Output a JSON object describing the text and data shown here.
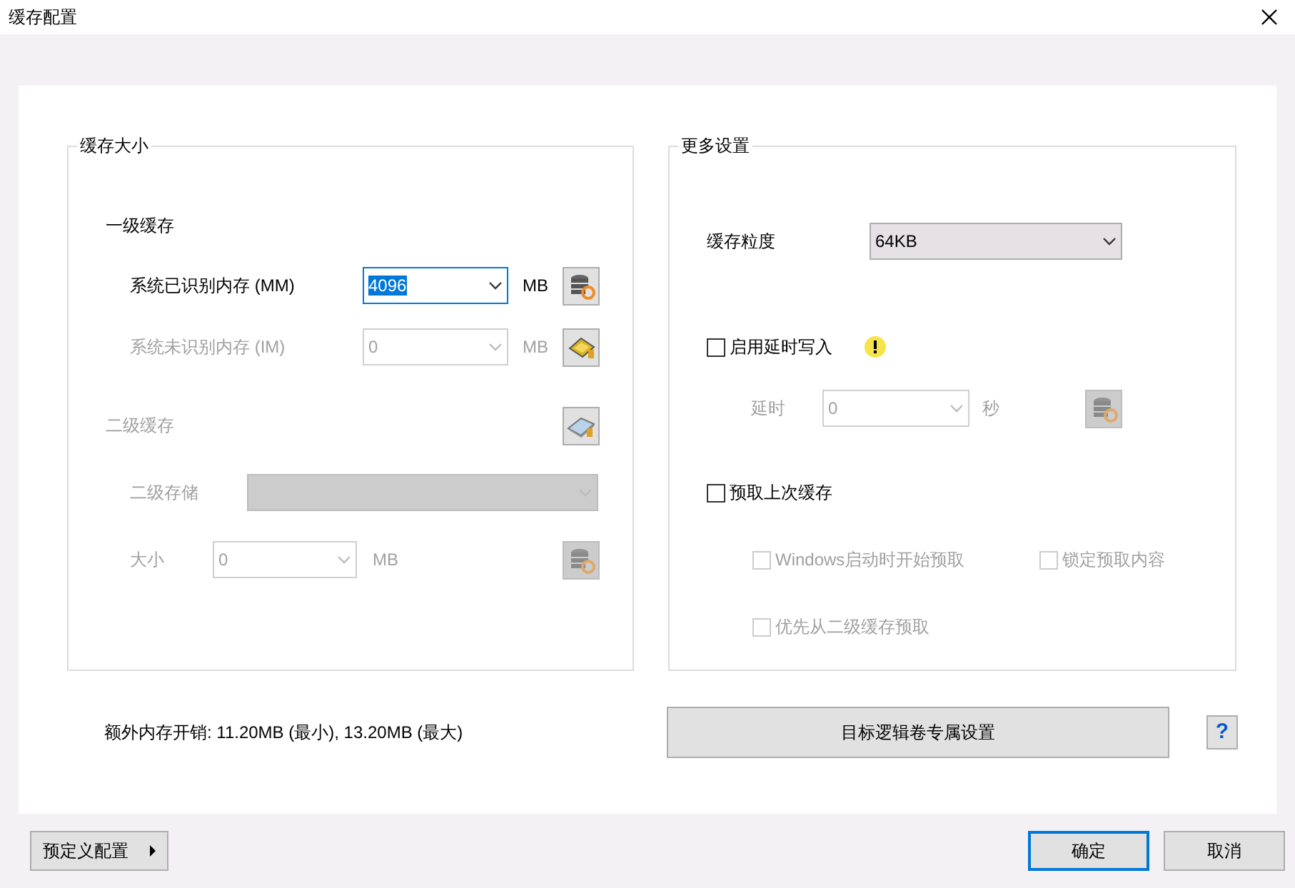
{
  "window": {
    "title": "缓存配置"
  },
  "cache_size": {
    "title": "缓存大小",
    "level1": {
      "heading": "一级缓存",
      "disabled": false,
      "rows": [
        {
          "label": "系统已识别内存 (MM)",
          "value": "4096",
          "unit": "MB",
          "disabled": false,
          "focused": true
        },
        {
          "label": "系统未识别内存 (IM)",
          "value": "0",
          "unit": "MB",
          "disabled": true,
          "focused": false
        }
      ]
    },
    "level2": {
      "heading": "二级缓存",
      "disabled": true,
      "storage": {
        "label": "二级存储",
        "disabled": true
      },
      "size": {
        "label": "大小",
        "value": "0",
        "unit": "MB",
        "disabled": true
      }
    }
  },
  "more_settings": {
    "title": "更多设置",
    "granularity": {
      "label": "缓存粒度",
      "value": "64KB"
    },
    "delayed_write": {
      "label": "启用延时写入",
      "checked": false
    },
    "delay": {
      "label": "延时",
      "value": "0",
      "unit": "秒",
      "disabled": true
    },
    "prefetch": {
      "label": "预取上次缓存",
      "checked": false
    },
    "prefetch_options": [
      {
        "label": "Windows启动时开始预取",
        "checked": false,
        "disabled": true
      },
      {
        "label": "锁定预取内容",
        "checked": false,
        "disabled": true
      },
      {
        "label": "优先从二级缓存预取",
        "checked": false,
        "disabled": true
      }
    ]
  },
  "overhead": "额外内存开销: 11.20MB (最小), 13.20MB (最大)",
  "volume_button": "目标逻辑卷专属设置",
  "help": "?",
  "footer": {
    "preset_button": "预定义配置",
    "ok": "确定",
    "cancel": "取消"
  }
}
